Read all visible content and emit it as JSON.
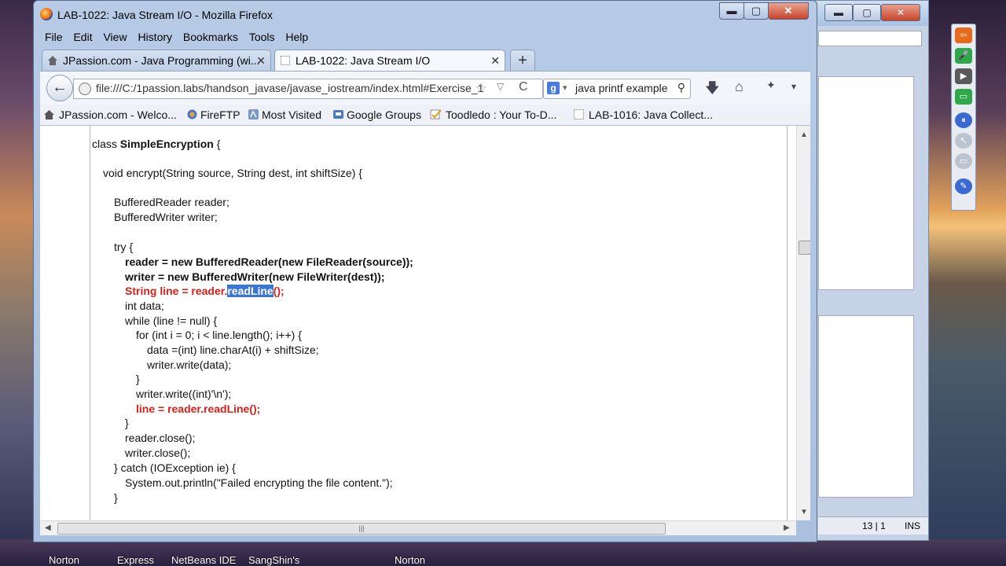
{
  "window": {
    "title": "LAB-1022: Java Stream I/O - Mozilla Firefox",
    "controls": {
      "minimize": "▬",
      "maximize": "▢",
      "close": "✕"
    }
  },
  "menu": [
    "File",
    "Edit",
    "View",
    "History",
    "Bookmarks",
    "Tools",
    "Help"
  ],
  "tabs": [
    {
      "label": "JPassion.com - Java Programming (wi...",
      "active": false,
      "close": "✕"
    },
    {
      "label": "LAB-1022: Java Stream I/O",
      "active": true,
      "close": "✕"
    }
  ],
  "new_tab": "+",
  "navigation": {
    "back": "←",
    "url": "file:///C:/1passion.labs/handson_javase/javase_iostream/index.html#Exercise_1",
    "bookmark_star": "☆",
    "history_drop": "▽",
    "reload": "C",
    "search_engine": "g",
    "search_drop": "▾",
    "search_query": "java printf example",
    "search_glass": "⚲",
    "download": "🡇",
    "home": "⌂",
    "addon": "✦",
    "menu": "▾"
  },
  "bookmarks": [
    {
      "label": "JPassion.com - Welco...",
      "icon": "house-icon"
    },
    {
      "label": "FireFTP",
      "icon": "fireftp-icon"
    },
    {
      "label": "Most Visited",
      "icon": "most-visited-icon"
    },
    {
      "label": "Google Groups",
      "icon": "google-groups-icon"
    },
    {
      "label": "Toodledo : Your To-D...",
      "icon": "checkmark-icon"
    },
    {
      "label": "LAB-1016: Java Collect...",
      "icon": "page-icon"
    }
  ],
  "code": {
    "l1a": "class ",
    "l1b": "SimpleEncryption",
    "l1c": " {",
    "l2": "void encrypt(String source, String dest, int shiftSize) {",
    "l3": "BufferedReader reader;",
    "l4": "BufferedWriter writer;",
    "l5": "try {",
    "l6": "reader = new BufferedReader(new FileReader(source));",
    "l7": "writer = new BufferedWriter(new FileWriter(dest));",
    "l8a": "String line = reader.",
    "l8b": "readLine",
    "l8c": "();",
    "l9": "int data;",
    "l10": "while (line != null) {",
    "l11": "for (int i = 0; i < line.length(); i++) {",
    "l12": "data =(int) line.charAt(i) + shiftSize;",
    "l13": "writer.write(data);",
    "l14": "}",
    "l15": "writer.write((int)'\\n');",
    "l16": "line = reader.readLine();",
    "l17": "}",
    "l18": "reader.close();",
    "l19": "writer.close();",
    "l20": "} catch (IOException ie) {",
    "l21": "System.out.println(\"Failed encrypting the file content.\");",
    "l22": "}"
  },
  "scroll": {
    "up": "▲",
    "down": "▼",
    "left": "◀",
    "right": "▶",
    "grip": "|||"
  },
  "ide_status": {
    "position": "13 | 1",
    "mode": "INS"
  },
  "taskbar": [
    "Norton",
    "Express",
    "NetBeans IDE",
    "SangShin's",
    "Norton"
  ]
}
